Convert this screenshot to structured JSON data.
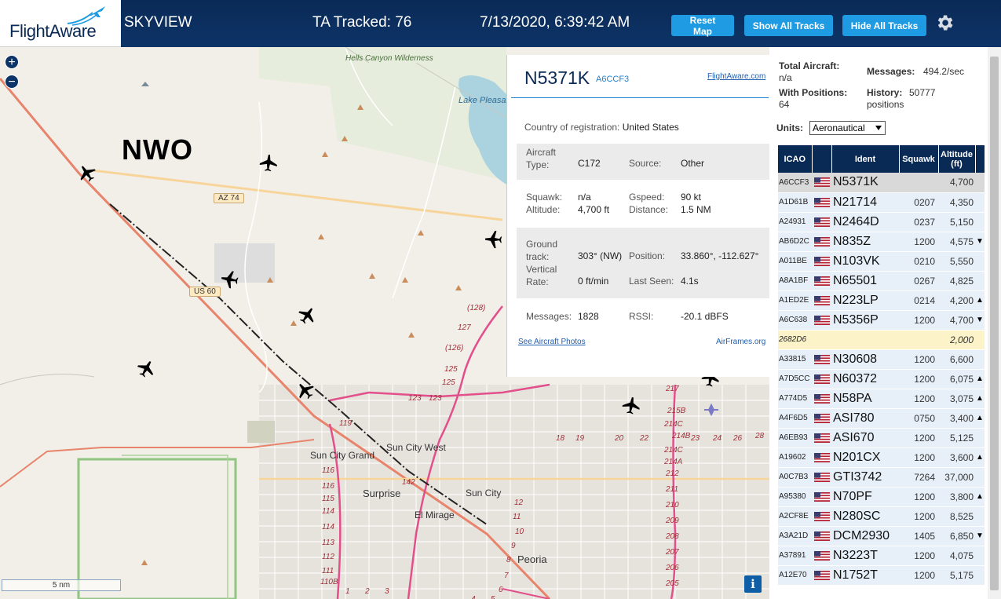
{
  "header": {
    "logo_text": "FlightAware",
    "app_name": "SKYVIEW",
    "ta_tracked": "TA Tracked: 76",
    "datetime": "7/13/2020, 6:39:42 AM",
    "buttons": {
      "reset_map": "Reset Map",
      "show_all_tracks": "Show All Tracks",
      "hide_all_tracks": "Hide All Tracks"
    },
    "settings_icon": "gear-icon"
  },
  "map": {
    "overlay_label": "NWO",
    "zoom_in": "+",
    "zoom_out": "−",
    "scale_label": "5 nm",
    "info_button": "i",
    "places": [
      {
        "id": "hells-canyon",
        "text": "Hells Canyon Wilderness"
      },
      {
        "id": "lake-pleasant",
        "text": "Lake Pleasant Regional Park"
      },
      {
        "id": "sun-city-grand",
        "text": "Sun City Grand"
      },
      {
        "id": "sun-city-west",
        "text": "Sun City West"
      },
      {
        "id": "surprise",
        "text": "Surprise"
      },
      {
        "id": "sun-city",
        "text": "Sun City"
      },
      {
        "id": "el-mirage",
        "text": "El Mirage"
      },
      {
        "id": "peoria",
        "text": "Peoria"
      }
    ],
    "shields": [
      "AZ 74",
      "US 60"
    ],
    "route_numbers": [
      "(128)",
      "127",
      "(126)",
      "125",
      "125",
      "123",
      "123",
      "119",
      "116",
      "116",
      "115",
      "114",
      "114",
      "113",
      "112",
      "111",
      "110B",
      "142",
      "12",
      "11",
      "10",
      "9",
      "8",
      "7",
      "6",
      "5",
      "4",
      "3",
      "2",
      "1",
      "217",
      "215B",
      "214C",
      "214B",
      "214C",
      "214A",
      "212",
      "211",
      "210",
      "209",
      "208",
      "207",
      "206",
      "205",
      "18",
      "19",
      "20",
      "22",
      "23",
      "24",
      "26",
      "28"
    ]
  },
  "selected_aircraft": {
    "callsign": "N5371K",
    "icao": "A6CCF3",
    "fa_link": "FlightAware.com",
    "country_label": "Country of registration:",
    "country_value": "United States",
    "aircraft_type_label": "Aircraft Type:",
    "aircraft_type_value": "C172",
    "source_label": "Source:",
    "source_value": "Other",
    "squawk_label": "Squawk:",
    "squawk_value": "n/a",
    "gspeed_label": "Gspeed:",
    "gspeed_value": "90 kt",
    "altitude_label": "Altitude:",
    "altitude_value": "4,700 ft",
    "distance_label": "Distance:",
    "distance_value": "1.5 NM",
    "ground_track_label": "Ground track:",
    "ground_track_value": "303° (NW)",
    "position_label": "Position:",
    "position_value": "33.860°, -112.627°",
    "vertical_rate_label": "Vertical Rate:",
    "vertical_rate_value": "0 ft/min",
    "last_seen_label": "Last Seen:",
    "last_seen_value": "4.1s",
    "messages_label": "Messages:",
    "messages_value": "1828",
    "rssi_label": "RSSI:",
    "rssi_value": "-20.1 dBFS",
    "photos_link": "See Aircraft Photos",
    "airframes_link": "AirFrames.org"
  },
  "stats": {
    "total_aircraft_label": "Total Aircraft:",
    "total_aircraft_value": "n/a",
    "with_positions_label": "With Positions:",
    "with_positions_value": "64",
    "messages_label": "Messages:",
    "messages_value": "494.2/sec",
    "history_label": "History:",
    "history_value": "50777",
    "history_unit": "positions",
    "units_label": "Units:",
    "units_value": "Aeronautical"
  },
  "table": {
    "headers": {
      "icao": "ICAO",
      "ident": "Ident",
      "squawk": "Squawk",
      "altitude": "Altitude (ft)"
    },
    "rows": [
      {
        "icao": "A6CCF3",
        "ident": "N5371K",
        "squawk": "",
        "altitude": "4,700",
        "trend": "",
        "state": "sel"
      },
      {
        "icao": "A1D61B",
        "ident": "N21714",
        "squawk": "0207",
        "altitude": "4,350",
        "trend": "",
        "state": ""
      },
      {
        "icao": "A24931",
        "ident": "N2464D",
        "squawk": "0237",
        "altitude": "5,150",
        "trend": "",
        "state": ""
      },
      {
        "icao": "AB6D2C",
        "ident": "N835Z",
        "squawk": "1200",
        "altitude": "4,575",
        "trend": "▼",
        "state": ""
      },
      {
        "icao": "A011BE",
        "ident": "N103VK",
        "squawk": "0210",
        "altitude": "5,550",
        "trend": "",
        "state": ""
      },
      {
        "icao": "A8A1BF",
        "ident": "N65501",
        "squawk": "0267",
        "altitude": "4,825",
        "trend": "",
        "state": ""
      },
      {
        "icao": "A1ED2E",
        "ident": "N223LP",
        "squawk": "0214",
        "altitude": "4,200",
        "trend": "▲",
        "state": ""
      },
      {
        "icao": "A6C638",
        "ident": "N5356P",
        "squawk": "1200",
        "altitude": "4,700",
        "trend": "▼",
        "state": ""
      },
      {
        "icao": "2682D6",
        "ident": "",
        "squawk": "",
        "altitude": "2,000",
        "trend": "",
        "state": "nopos"
      },
      {
        "icao": "A33815",
        "ident": "N30608",
        "squawk": "1200",
        "altitude": "6,600",
        "trend": "",
        "state": ""
      },
      {
        "icao": "A7D5CC",
        "ident": "N60372",
        "squawk": "1200",
        "altitude": "6,075",
        "trend": "▲",
        "state": ""
      },
      {
        "icao": "A774D5",
        "ident": "N58PA",
        "squawk": "1200",
        "altitude": "3,075",
        "trend": "▲",
        "state": ""
      },
      {
        "icao": "A4F6D5",
        "ident": "ASI780",
        "squawk": "0750",
        "altitude": "3,400",
        "trend": "▲",
        "state": ""
      },
      {
        "icao": "A6EB93",
        "ident": "ASI670",
        "squawk": "1200",
        "altitude": "5,125",
        "trend": "",
        "state": ""
      },
      {
        "icao": "A19602",
        "ident": "N201CX",
        "squawk": "1200",
        "altitude": "3,600",
        "trend": "▲",
        "state": ""
      },
      {
        "icao": "A0C7B3",
        "ident": "GTI3742",
        "squawk": "7264",
        "altitude": "37,000",
        "trend": "",
        "state": ""
      },
      {
        "icao": "A95380",
        "ident": "N70PF",
        "squawk": "1200",
        "altitude": "3,800",
        "trend": "▲",
        "state": ""
      },
      {
        "icao": "A2CF8E",
        "ident": "N280SC",
        "squawk": "1200",
        "altitude": "8,525",
        "trend": "",
        "state": ""
      },
      {
        "icao": "A3A21D",
        "ident": "DCM2930",
        "squawk": "1405",
        "altitude": "6,850",
        "trend": "▼",
        "state": ""
      },
      {
        "icao": "A37891",
        "ident": "N3223T",
        "squawk": "1200",
        "altitude": "4,075",
        "trend": "",
        "state": ""
      },
      {
        "icao": "A12E70",
        "ident": "N1752T",
        "squawk": "1200",
        "altitude": "5,175",
        "trend": "",
        "state": ""
      }
    ]
  },
  "colors": {
    "header_bg": "#0a2a56",
    "button_blue": "#1f9be3",
    "row_bg": "#e7f0f9",
    "selected_row_bg": "#d9d9d9",
    "nopos_row_bg": "#fcf3c8"
  }
}
